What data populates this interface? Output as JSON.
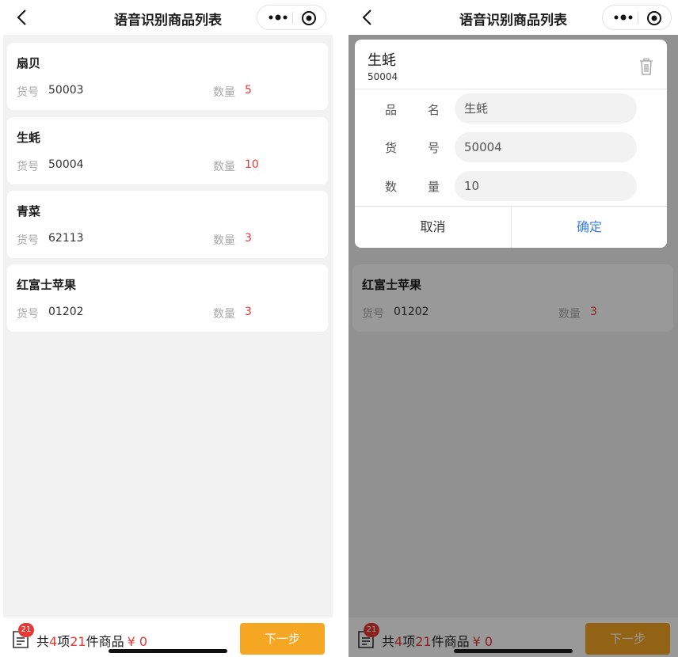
{
  "page_title": "语音识别商品列表",
  "items": [
    {
      "name": "扇贝",
      "code_label": "货号",
      "code": "50003",
      "qty_label": "数量",
      "qty": "5"
    },
    {
      "name": "生蚝",
      "code_label": "货号",
      "code": "50004",
      "qty_label": "数量",
      "qty": "10"
    },
    {
      "name": "青菜",
      "code_label": "货号",
      "code": "62113",
      "qty_label": "数量",
      "qty": "3"
    },
    {
      "name": "红富士苹果",
      "code_label": "货号",
      "code": "01202",
      "qty_label": "数量",
      "qty": "3"
    }
  ],
  "summary": {
    "badge": "21",
    "prefix": "共",
    "item_count": "4",
    "mid": "项",
    "piece_count": "21",
    "suffix": "件商品",
    "price": "¥ 0",
    "next_label": "下一步"
  },
  "dialog": {
    "title": "生蚝",
    "code": "50004",
    "fields": [
      {
        "label_a": "品",
        "label_b": "名",
        "value": "生蚝"
      },
      {
        "label_a": "货",
        "label_b": "号",
        "value": "50004"
      },
      {
        "label_a": "数",
        "label_b": "量",
        "value": "10"
      }
    ],
    "cancel_label": "取消",
    "confirm_label": "确定"
  },
  "colors": {
    "accent": "#f5a623",
    "highlight": "#e53935",
    "link": "#3b7de0"
  },
  "icons": [
    "back-chevron-icon",
    "more-dots-icon",
    "target-icon",
    "cart-list-icon",
    "trash-icon"
  ]
}
